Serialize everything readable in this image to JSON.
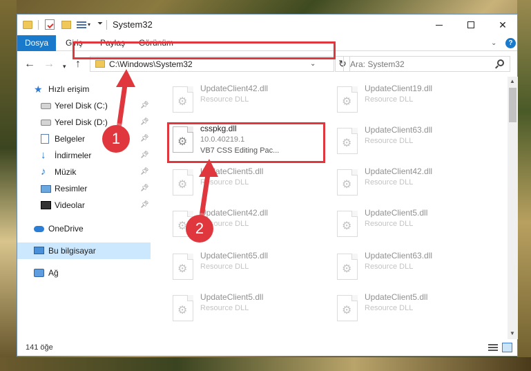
{
  "window": {
    "title": "System32",
    "ribbon_tabs": [
      "Dosya",
      "Giriş",
      "Paylaş",
      "Görünüm"
    ],
    "help_label": "?"
  },
  "navigation": {
    "address": "C:\\Windows\\System32",
    "search_placeholder": "Ara: System32"
  },
  "sidebar": {
    "items": [
      {
        "label": "Hızlı erişim",
        "icon": "quick-access-star-icon"
      },
      {
        "label": "Yerel Disk (C:)",
        "icon": "drive-icon",
        "pinned": true
      },
      {
        "label": "Yerel Disk (D:)",
        "icon": "drive-icon",
        "pinned": true
      },
      {
        "label": "Belgeler",
        "icon": "documents-icon",
        "pinned": true
      },
      {
        "label": "İndirmeler",
        "icon": "downloads-icon",
        "pinned": true
      },
      {
        "label": "Müzik",
        "icon": "music-icon",
        "pinned": true
      },
      {
        "label": "Resimler",
        "icon": "pictures-icon",
        "pinned": true
      },
      {
        "label": "Videolar",
        "icon": "videos-icon",
        "pinned": true
      },
      {
        "label": "OneDrive",
        "icon": "onedrive-icon"
      },
      {
        "label": "Bu bilgisayar",
        "icon": "this-pc-icon",
        "selected": true
      },
      {
        "label": "Ağ",
        "icon": "network-icon"
      }
    ]
  },
  "files": {
    "left": [
      {
        "name": "UpdateClient42.dll",
        "desc": "Resource DLL"
      },
      {
        "name": "csspkg.dll",
        "version": "10.0.40219.1",
        "desc": "VB7 CSS Editing Pac..."
      },
      {
        "name": "UpdateClient5.dll",
        "desc": "Resource DLL"
      },
      {
        "name": "UpdateClient42.dll",
        "desc": "Resource DLL"
      },
      {
        "name": "UpdateClient65.dll",
        "desc": "Resource DLL"
      },
      {
        "name": "UpdateClient5.dll",
        "desc": "Resource DLL"
      }
    ],
    "right": [
      {
        "name": "UpdateClient19.dll",
        "desc": "Resource DLL"
      },
      {
        "name": "UpdateClient63.dll",
        "desc": "Resource DLL"
      },
      {
        "name": "UpdateClient42.dll",
        "desc": "Resource DLL"
      },
      {
        "name": "UpdateClient5.dll",
        "desc": "Resource DLL"
      },
      {
        "name": "UpdateClient63.dll",
        "desc": "Resource DLL"
      },
      {
        "name": "UpdateClient5.dll",
        "desc": "Resource DLL"
      }
    ]
  },
  "status": {
    "item_count": "141 öğe"
  },
  "annotations": {
    "step1": "1",
    "step2": "2",
    "highlight_color": "#e0373e"
  }
}
